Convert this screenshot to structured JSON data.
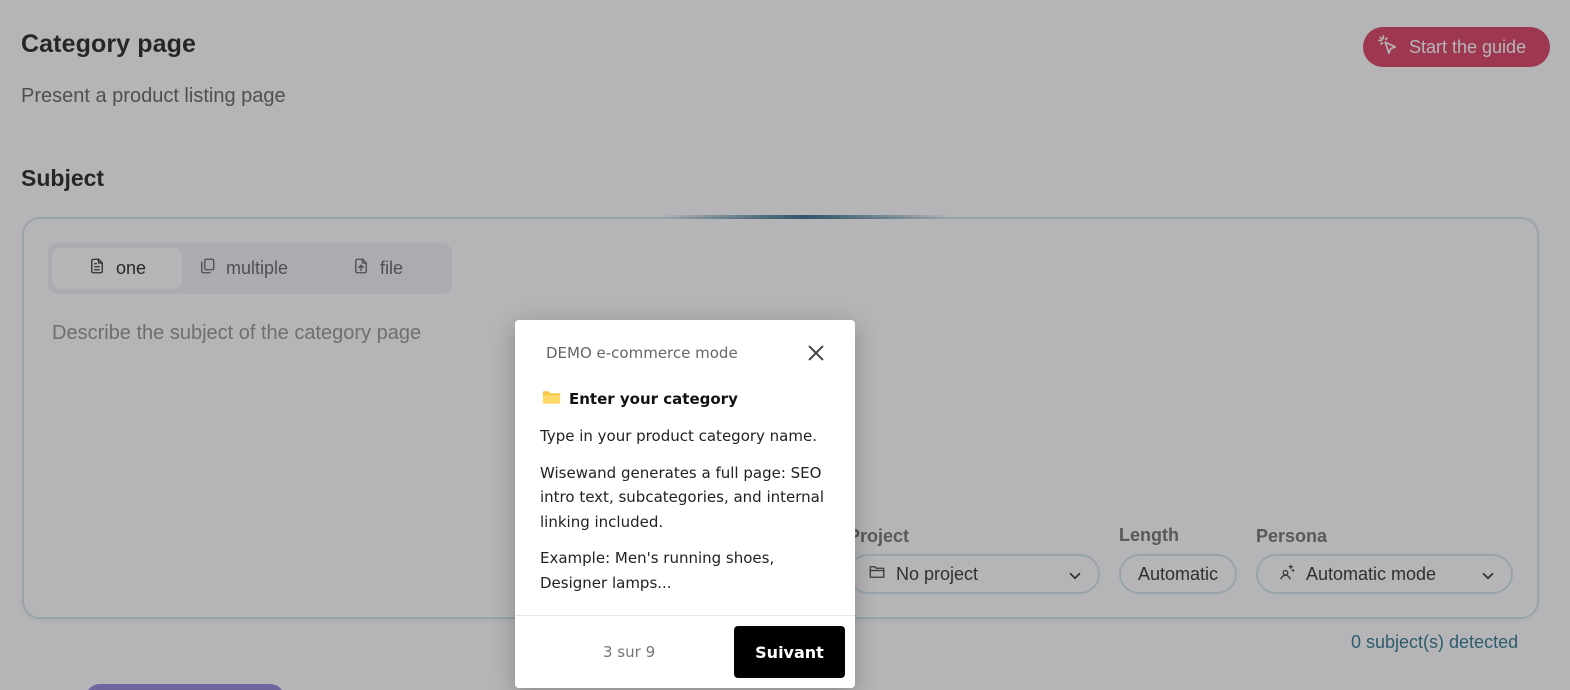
{
  "header": {
    "title": "Category page",
    "subtitle": "Present a product listing page",
    "guide_button": "Start the guide"
  },
  "subject": {
    "section_title": "Subject",
    "tabs": [
      {
        "label": "one",
        "active": true
      },
      {
        "label": "multiple"
      },
      {
        "label": "file"
      }
    ],
    "input_placeholder": "Describe the subject of the category page",
    "project": {
      "label": "Project",
      "value": "No project"
    },
    "length": {
      "label": "Length",
      "value": "Automatic"
    },
    "persona": {
      "label": "Persona",
      "value": "Automatic mode"
    },
    "detected": "0 subject(s) detected"
  },
  "tour": {
    "header": "DEMO e-commerce mode",
    "step_title": "Enter your category",
    "body": [
      "Type in your product category name.",
      "Wisewand generates a full page: SEO intro text, subcategories, and internal linking included.",
      "Example: Men's running shoes, Designer lamps..."
    ],
    "progress": "3 sur 9",
    "next": "Suivant"
  },
  "colors": {
    "accent": "#d92f55",
    "link": "#1e6a84",
    "border": "#cfe3ea",
    "folder": "#f7c548"
  }
}
